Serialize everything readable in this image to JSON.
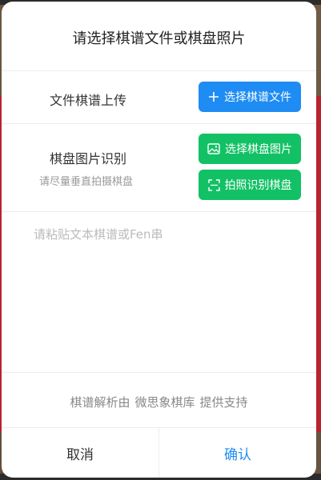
{
  "dialog": {
    "title": "请选择棋谱文件或棋盘照片",
    "file_section": {
      "label": "文件棋谱上传",
      "button_label": "选择棋谱文件",
      "button_icon": "plus-icon"
    },
    "image_section": {
      "label": "棋盘图片识别",
      "hint": "请尽量垂直拍摄棋盘",
      "select_button_label": "选择棋盘图片",
      "select_button_icon": "image-icon",
      "camera_button_label": "拍照识别棋盘",
      "camera_button_icon": "scan-icon"
    },
    "paste_placeholder": "请粘贴文本棋谱或Fen串",
    "footer": {
      "prefix": "棋谱解析由",
      "provider": "微思象棋库",
      "suffix": "提供支持"
    },
    "cancel_label": "取消",
    "confirm_label": "确认"
  },
  "colors": {
    "primary_blue": "#1e8cf3",
    "action_green": "#12c165"
  }
}
